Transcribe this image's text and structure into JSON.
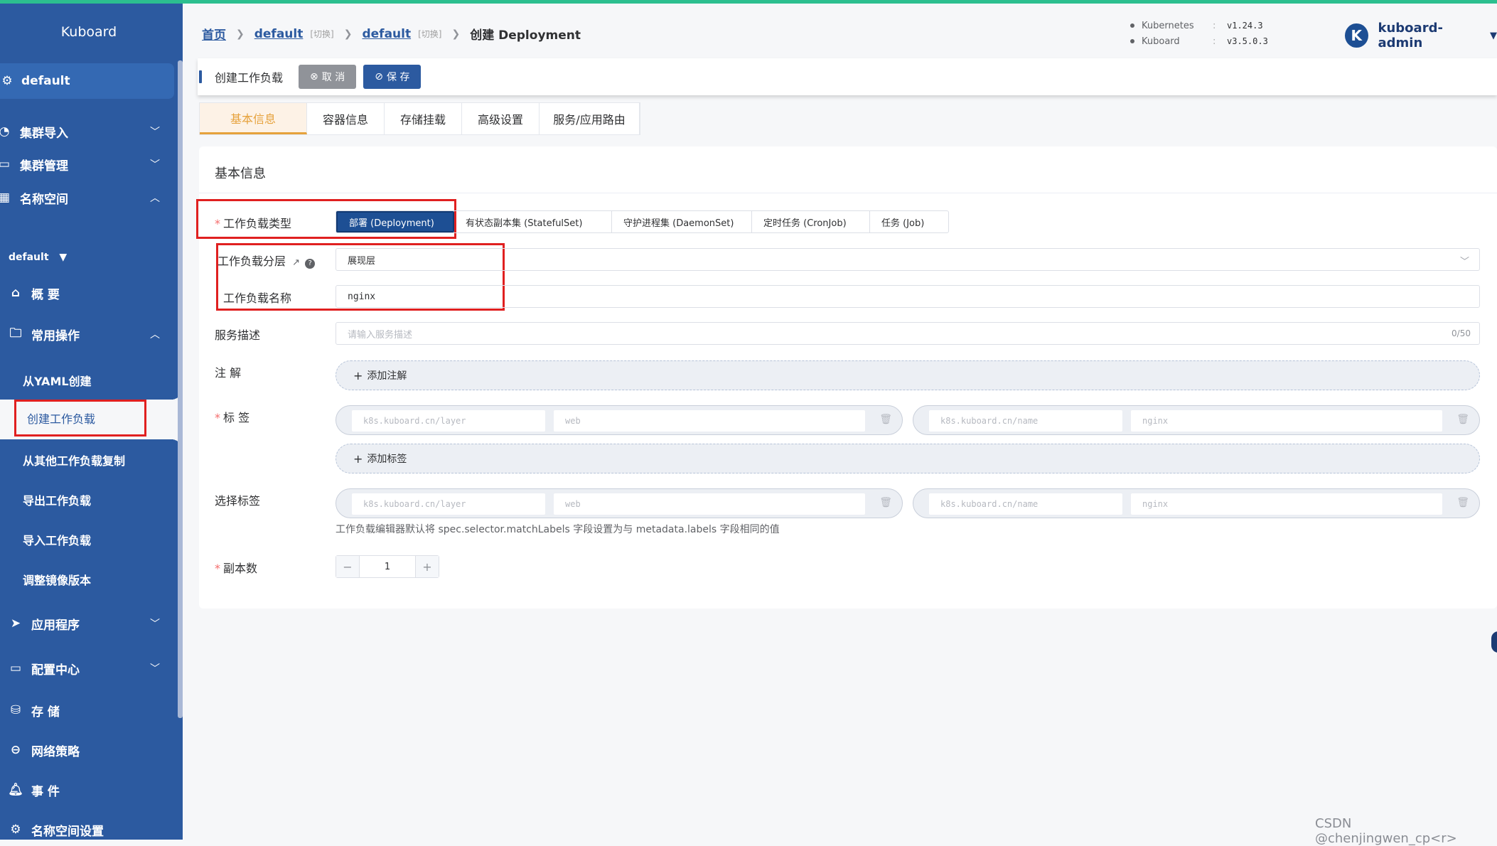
{
  "sidebar": {
    "brand": "Kuboard",
    "namespace_bar": "default",
    "items": {
      "cluster_import": "集群导入",
      "cluster_manage": "集群管理",
      "namespace": "名称空间",
      "ns_select": "default",
      "overview": "概 要",
      "common_ops": "常用操作",
      "from_yaml": "从YAML创建",
      "create_workload": "创建工作负载",
      "copy_workload": "从其他工作负载复制",
      "export_workload": "导出工作负载",
      "import_workload": "导入工作负载",
      "adjust_image": "调整镜像版本",
      "apps": "应用程序",
      "config_center": "配置中心",
      "storage": "存 储",
      "net_policy": "网络策略",
      "events": "事 件",
      "ns_settings": "名称空间设置"
    }
  },
  "breadcrumb": {
    "home": "首页",
    "cluster": "default",
    "cluster_switch": "[切换]",
    "namespace": "default",
    "namespace_switch": "[切换]",
    "current": "创建 Deployment"
  },
  "versions": {
    "kubernetes_label": "Kubernetes",
    "kubernetes_value": "v1.24.3",
    "kuboard_label": "Kuboard",
    "kuboard_value": "v3.5.0.3",
    "colon": ":"
  },
  "user": {
    "avatar_letter": "K",
    "name": "kuboard-admin"
  },
  "toolbar": {
    "title": "创建工作负载",
    "cancel": "取 消",
    "save": "保 存"
  },
  "tabs": [
    "基本信息",
    "容器信息",
    "存储挂载",
    "高级设置",
    "服务/应用路由"
  ],
  "form": {
    "section_title": "基本信息",
    "workload_type_label": "工作负载类型",
    "workload_types": [
      "部署 (Deployment)",
      "有状态副本集 (StatefulSet)",
      "守护进程集 (DaemonSet)",
      "定时任务 (CronJob)",
      "任务 (Job)"
    ],
    "layer_label": "工作负载分层",
    "layer_value": "展现层",
    "name_label": "工作负载名称",
    "name_value": "nginx",
    "desc_label": "服务描述",
    "desc_placeholder": "请输入服务描述",
    "desc_count": "0/50",
    "annotation_label": "注 解",
    "add_annotation": "添加注解",
    "labels_label": "标 签",
    "label_pairs": [
      {
        "key": "k8s.kuboard.cn/layer",
        "value": "web"
      },
      {
        "key": "k8s.kuboard.cn/name",
        "value": "nginx"
      }
    ],
    "add_label": "添加标签",
    "selector_label": "选择标签",
    "selector_pairs": [
      {
        "key": "k8s.kuboard.cn/layer",
        "value": "web"
      },
      {
        "key": "k8s.kuboard.cn/name",
        "value": "nginx"
      }
    ],
    "selector_hint": "工作负载编辑器默认将 spec.selector.matchLabels 字段设置为与 metadata.labels 字段相同的值",
    "replicas_label": "副本数",
    "replicas_value": "1",
    "stepper_minus": "−",
    "stepper_plus": "+",
    "required_mark": "*"
  },
  "watermark": "CSDN @chenjingwen_cp<r>"
}
